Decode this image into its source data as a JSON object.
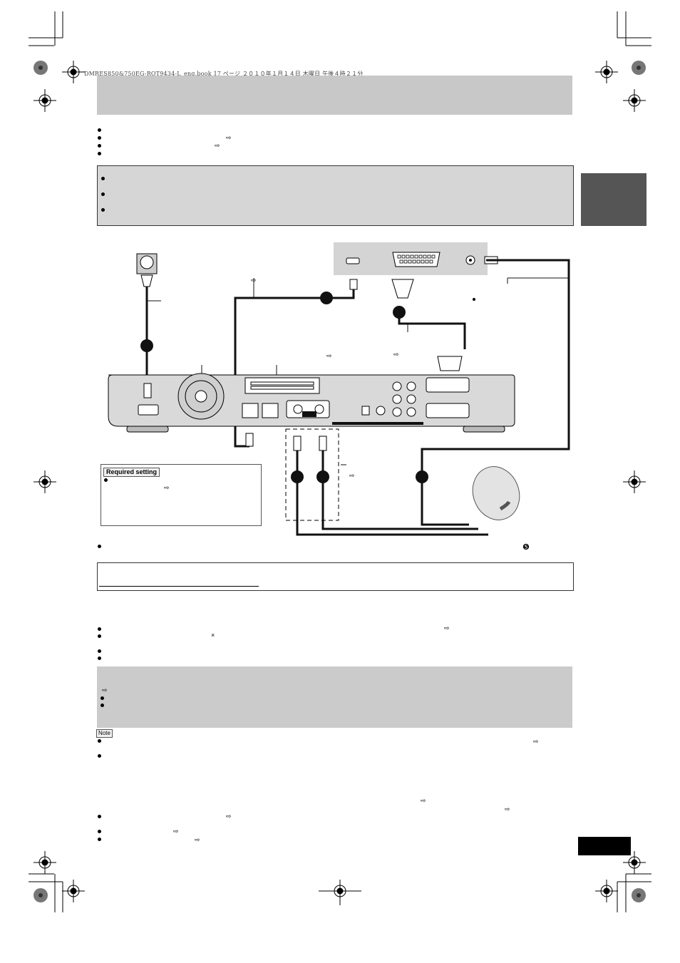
{
  "header": {
    "file_line": "DMRES850&750EG-RQT9434-L_eng.book  17 ページ  ２０１０年１月１４日  木曜日  午後４時２１分"
  },
  "symbols": {
    "arrow": "⇨",
    "times": "×",
    "circled_five": "❺"
  },
  "diagram": {
    "required_setting_label": "Required setting",
    "connection_markers": [
      "",
      "",
      "",
      "",
      "",
      ""
    ]
  },
  "notes": {
    "note_label": "Note"
  },
  "colors": {
    "title_bar": "#c8c8c8",
    "side_tab": "#555555",
    "gray_box": "#d6d6d6",
    "page_number_block": "#000000"
  }
}
